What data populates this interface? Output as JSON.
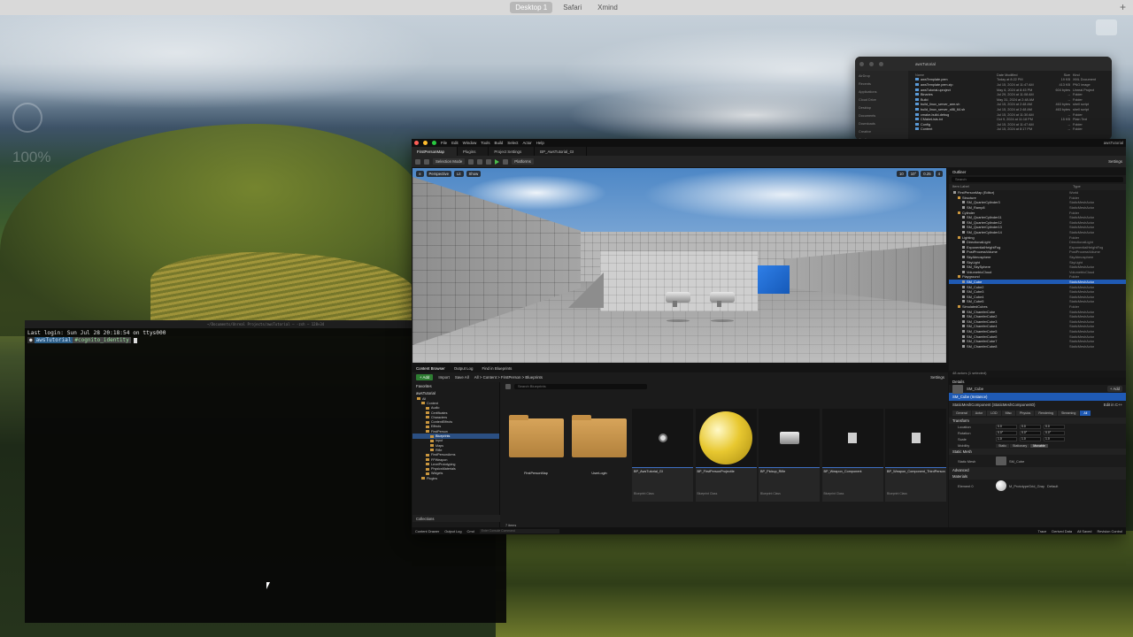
{
  "desktop": {
    "spaces": [
      "Desktop 1",
      "Safari",
      "Xmind"
    ],
    "active_space": "Desktop 1",
    "plus": "+",
    "gauge_text": "100%"
  },
  "terminal": {
    "title": "~/Documents/Unreal Projects/awsTutorial — -zsh — 128×34",
    "login_line": "Last login: Sun Jul 28 20:18:54 on ttys000",
    "prompt_user": "",
    "prompt_path": "awsTutorial",
    "prompt_cmd": "#cognito_identity"
  },
  "finder": {
    "title": "awsTutorial",
    "sidebar": [
      "AirDrop",
      "Recents",
      "Applications",
      "Cloud Drive",
      "Desktop",
      "Documents",
      "Downloads",
      "Creative",
      "Config"
    ],
    "headers": [
      "Name",
      "Date Modified",
      "Size",
      "Kind"
    ],
    "rows": [
      [
        "awsTemplate.pem",
        "Today at 8:22 PM",
        "19 KB",
        "XML Document"
      ],
      [
        "awsTemplate.pem.zip",
        "Jul 15, 2024 at 11:47 AM",
        "413 KB",
        "PNG image"
      ],
      [
        "awsTutorial.uproject",
        "May 6, 2024 at 8:45 PM",
        "604 bytes",
        "Unreal Project"
      ],
      [
        "Binaries",
        "Jul 29, 2024 at 11:08 AM",
        "--",
        "Folder"
      ],
      [
        "Build",
        "May 31, 2024 at 2:48 AM",
        "--",
        "Folder"
      ],
      [
        "build_linux_server_arm.sh",
        "Jul 15, 2024 at 2:48 AM",
        "463 bytes",
        "shell script"
      ],
      [
        "build_linux_server_x86_64.sh",
        "Jul 15, 2024 at 2:48 AM",
        "463 bytes",
        "shell script"
      ],
      [
        "cmake-build-debug",
        "Jul 15, 2024 at 11:30 AM",
        "--",
        "Folder"
      ],
      [
        "CMakeLists.txt",
        "Oct 9, 2024 at 11:18 PM",
        "15 KB",
        "Plain Text"
      ],
      [
        "Config",
        "Jul 15, 2024 at 11:47 AM",
        "--",
        "Folder"
      ],
      [
        "Content",
        "Jul 15, 2024 at 8:17 PM",
        "--",
        "Folder"
      ]
    ]
  },
  "ue": {
    "menus": [
      "File",
      "Edit",
      "Window",
      "Tools",
      "Build",
      "Select",
      "Actor",
      "Help"
    ],
    "project_name": "awsTutorial",
    "tabs": [
      "FirstPersonMap",
      "Plugins",
      "Project Settings",
      "BP_AwsTutorial_GI"
    ],
    "toolbar": {
      "mode": "Selection Mode",
      "platforms": "Platforms",
      "settings": "Settings"
    },
    "viewport": {
      "perspective": "Perspective",
      "lit": "Lit",
      "show": "Show",
      "right_values": [
        "10",
        "10°",
        "0.25",
        "4"
      ]
    },
    "outliner": {
      "tab": "Outliner",
      "search_placeholder": "Search",
      "col_label": "Item Label",
      "col_type": "Type",
      "rows": [
        {
          "name": "FirstPersonMap (Editor)",
          "type": "World",
          "ind": 1,
          "folder": false,
          "sel": false
        },
        {
          "name": "Structure",
          "type": "Folder",
          "ind": 2,
          "folder": true,
          "sel": false
        },
        {
          "name": "SM_QuarterCylinder3",
          "type": "StaticMeshActor",
          "ind": 3,
          "folder": false,
          "sel": false
        },
        {
          "name": "SM_Ramp8",
          "type": "StaticMeshActor",
          "ind": 3,
          "folder": false,
          "sel": false
        },
        {
          "name": "Cylinder",
          "type": "Folder",
          "ind": 2,
          "folder": true,
          "sel": false
        },
        {
          "name": "SM_QuarterCylinder11",
          "type": "StaticMeshActor",
          "ind": 3,
          "folder": false,
          "sel": false
        },
        {
          "name": "SM_QuarterCylinder12",
          "type": "StaticMeshActor",
          "ind": 3,
          "folder": false,
          "sel": false
        },
        {
          "name": "SM_QuarterCylinder13",
          "type": "StaticMeshActor",
          "ind": 3,
          "folder": false,
          "sel": false
        },
        {
          "name": "SM_QuarterCylinder14",
          "type": "StaticMeshActor",
          "ind": 3,
          "folder": false,
          "sel": false
        },
        {
          "name": "Lighting",
          "type": "Folder",
          "ind": 2,
          "folder": true,
          "sel": false
        },
        {
          "name": "DirectionalLight",
          "type": "DirectionalLight",
          "ind": 3,
          "folder": false,
          "sel": false
        },
        {
          "name": "ExponentialHeightFog",
          "type": "ExponentialHeightFog",
          "ind": 3,
          "folder": false,
          "sel": false
        },
        {
          "name": "PostProcessVolume",
          "type": "PostProcessVolume",
          "ind": 3,
          "folder": false,
          "sel": false
        },
        {
          "name": "SkyAtmosphere",
          "type": "SkyAtmosphere",
          "ind": 3,
          "folder": false,
          "sel": false
        },
        {
          "name": "SkyLight",
          "type": "SkyLight",
          "ind": 3,
          "folder": false,
          "sel": false
        },
        {
          "name": "SM_SkySphere",
          "type": "StaticMeshActor",
          "ind": 3,
          "folder": false,
          "sel": false
        },
        {
          "name": "VolumetricCloud",
          "type": "VolumetricCloud",
          "ind": 3,
          "folder": false,
          "sel": false
        },
        {
          "name": "Playground",
          "type": "Folder",
          "ind": 2,
          "folder": true,
          "sel": false
        },
        {
          "name": "SM_Cube",
          "type": "StaticMeshActor",
          "ind": 3,
          "folder": false,
          "sel": true
        },
        {
          "name": "SM_Cube2",
          "type": "StaticMeshActor",
          "ind": 3,
          "folder": false,
          "sel": false
        },
        {
          "name": "SM_Cube3",
          "type": "StaticMeshActor",
          "ind": 3,
          "folder": false,
          "sel": false
        },
        {
          "name": "SM_Cube4",
          "type": "StaticMeshActor",
          "ind": 3,
          "folder": false,
          "sel": false
        },
        {
          "name": "SM_Cube5",
          "type": "StaticMeshActor",
          "ind": 3,
          "folder": false,
          "sel": false
        },
        {
          "name": "SimulatedCubes",
          "type": "Folder",
          "ind": 2,
          "folder": true,
          "sel": false
        },
        {
          "name": "SM_ChamferCube",
          "type": "StaticMeshActor",
          "ind": 3,
          "folder": false,
          "sel": false
        },
        {
          "name": "SM_ChamferCube2",
          "type": "StaticMeshActor",
          "ind": 3,
          "folder": false,
          "sel": false
        },
        {
          "name": "SM_ChamferCube3",
          "type": "StaticMeshActor",
          "ind": 3,
          "folder": false,
          "sel": false
        },
        {
          "name": "SM_ChamferCube4",
          "type": "StaticMeshActor",
          "ind": 3,
          "folder": false,
          "sel": false
        },
        {
          "name": "SM_ChamferCube5",
          "type": "StaticMeshActor",
          "ind": 3,
          "folder": false,
          "sel": false
        },
        {
          "name": "SM_ChamferCube6",
          "type": "StaticMeshActor",
          "ind": 3,
          "folder": false,
          "sel": false
        },
        {
          "name": "SM_ChamferCube7",
          "type": "StaticMeshActor",
          "ind": 3,
          "folder": false,
          "sel": false
        },
        {
          "name": "SM_ChamferCube8",
          "type": "StaticMeshActor",
          "ind": 3,
          "folder": false,
          "sel": false
        }
      ],
      "footer": "48 actors (1 selected)"
    },
    "details": {
      "tab": "Details",
      "actor": "SM_Cube",
      "add": "+ Add",
      "instance": "SM_Cube (Instance)",
      "component": "StaticMeshComponent (StaticMeshComponent0)",
      "edit_in_cpp": "Edit in C++",
      "filters": [
        "General",
        "Actor",
        "LOD",
        "Misc",
        "Physics",
        "Rendering",
        "Streaming",
        "All"
      ],
      "filter_on": "All",
      "transform": "Transform",
      "location": "Location",
      "rotation": "Rotation",
      "scale": "Scale",
      "loc_vals": [
        "0.0",
        "0.0",
        "0.0"
      ],
      "rot_vals": [
        "0.0°",
        "0.0°",
        "0.0°"
      ],
      "scale_vals": [
        "1.0",
        "1.0",
        "1.0"
      ],
      "mobility": "Mobility",
      "mob_opts": [
        "Static",
        "Stationary",
        "Movable"
      ],
      "mob_on": "Movable",
      "static_mesh_sec": "Static Mesh",
      "static_mesh_lbl": "Static Mesh",
      "static_mesh_val": "SM_Cube",
      "advanced": "Advanced",
      "materials": "Materials",
      "element0": "Element 0",
      "element0_val": "M_PrototypeGrid_Gray",
      "element0_sub": "Default"
    },
    "content_browser": {
      "tabs": [
        "Content Browser",
        "Output Log",
        "Find in Blueprints"
      ],
      "add": "+ Add",
      "import": "Import",
      "save_all": "Save All",
      "breadcrumb": "All  >  Content  >  FirstPerson  >  Blueprints",
      "settings": "Settings",
      "favorites": "Favorites",
      "tree_root": "awsTutorial",
      "tree": [
        {
          "label": "All",
          "ind": 1,
          "sel": false
        },
        {
          "label": "Content",
          "ind": 2,
          "sel": false
        },
        {
          "label": "Audio",
          "ind": 3,
          "sel": false
        },
        {
          "label": "Certificates",
          "ind": 3,
          "sel": false
        },
        {
          "label": "Characters",
          "ind": 3,
          "sel": false
        },
        {
          "label": "ContentEffects",
          "ind": 3,
          "sel": false
        },
        {
          "label": "Effects",
          "ind": 3,
          "sel": false
        },
        {
          "label": "FirstPerson",
          "ind": 3,
          "sel": false
        },
        {
          "label": "Blueprints",
          "ind": 4,
          "sel": true
        },
        {
          "label": "Input",
          "ind": 4,
          "sel": false
        },
        {
          "label": "Maps",
          "ind": 4,
          "sel": false
        },
        {
          "label": "Rifle",
          "ind": 4,
          "sel": false
        },
        {
          "label": "FirstPersonArms",
          "ind": 3,
          "sel": false
        },
        {
          "label": "FPWeapon",
          "ind": 3,
          "sel": false
        },
        {
          "label": "LevelPrototyping",
          "ind": 3,
          "sel": false
        },
        {
          "label": "PhysicsMaterials",
          "ind": 3,
          "sel": false
        },
        {
          "label": "Widgets",
          "ind": 3,
          "sel": false
        },
        {
          "label": "Plugins",
          "ind": 2,
          "sel": false
        }
      ],
      "search_placeholder": "Search Blueprints",
      "assets": [
        {
          "label": "FirstPersonMap",
          "kind": "",
          "type": "folder"
        },
        {
          "label": "UserLogin",
          "kind": "",
          "type": "folder"
        },
        {
          "label": "BP_AwsTutorial_GI",
          "kind": "Blueprint Class",
          "type": "bp"
        },
        {
          "label": "BP_FirstPersonProjectile",
          "kind": "Blueprint Class",
          "type": "sphere"
        },
        {
          "label": "BP_Pickup_Rifle",
          "kind": "Blueprint Class",
          "type": "gun"
        },
        {
          "label": "BP_Weapon_Component",
          "kind": "Blueprint Class",
          "type": "doc"
        },
        {
          "label": "BP_Weapon_Component_ThirdPerson",
          "kind": "Blueprint Class",
          "type": "doc"
        }
      ],
      "item_count": "7 items",
      "collections": "Collections"
    },
    "statusbar": {
      "content_drawer": "Content Drawer",
      "output_log": "Output Log",
      "cmd": "Cmd",
      "cmd_placeholder": "Enter Console Command",
      "trace": "Trace",
      "derived_data": "Derived Data",
      "all_saved": "All Saved",
      "revision_control": "Revision Control"
    }
  }
}
